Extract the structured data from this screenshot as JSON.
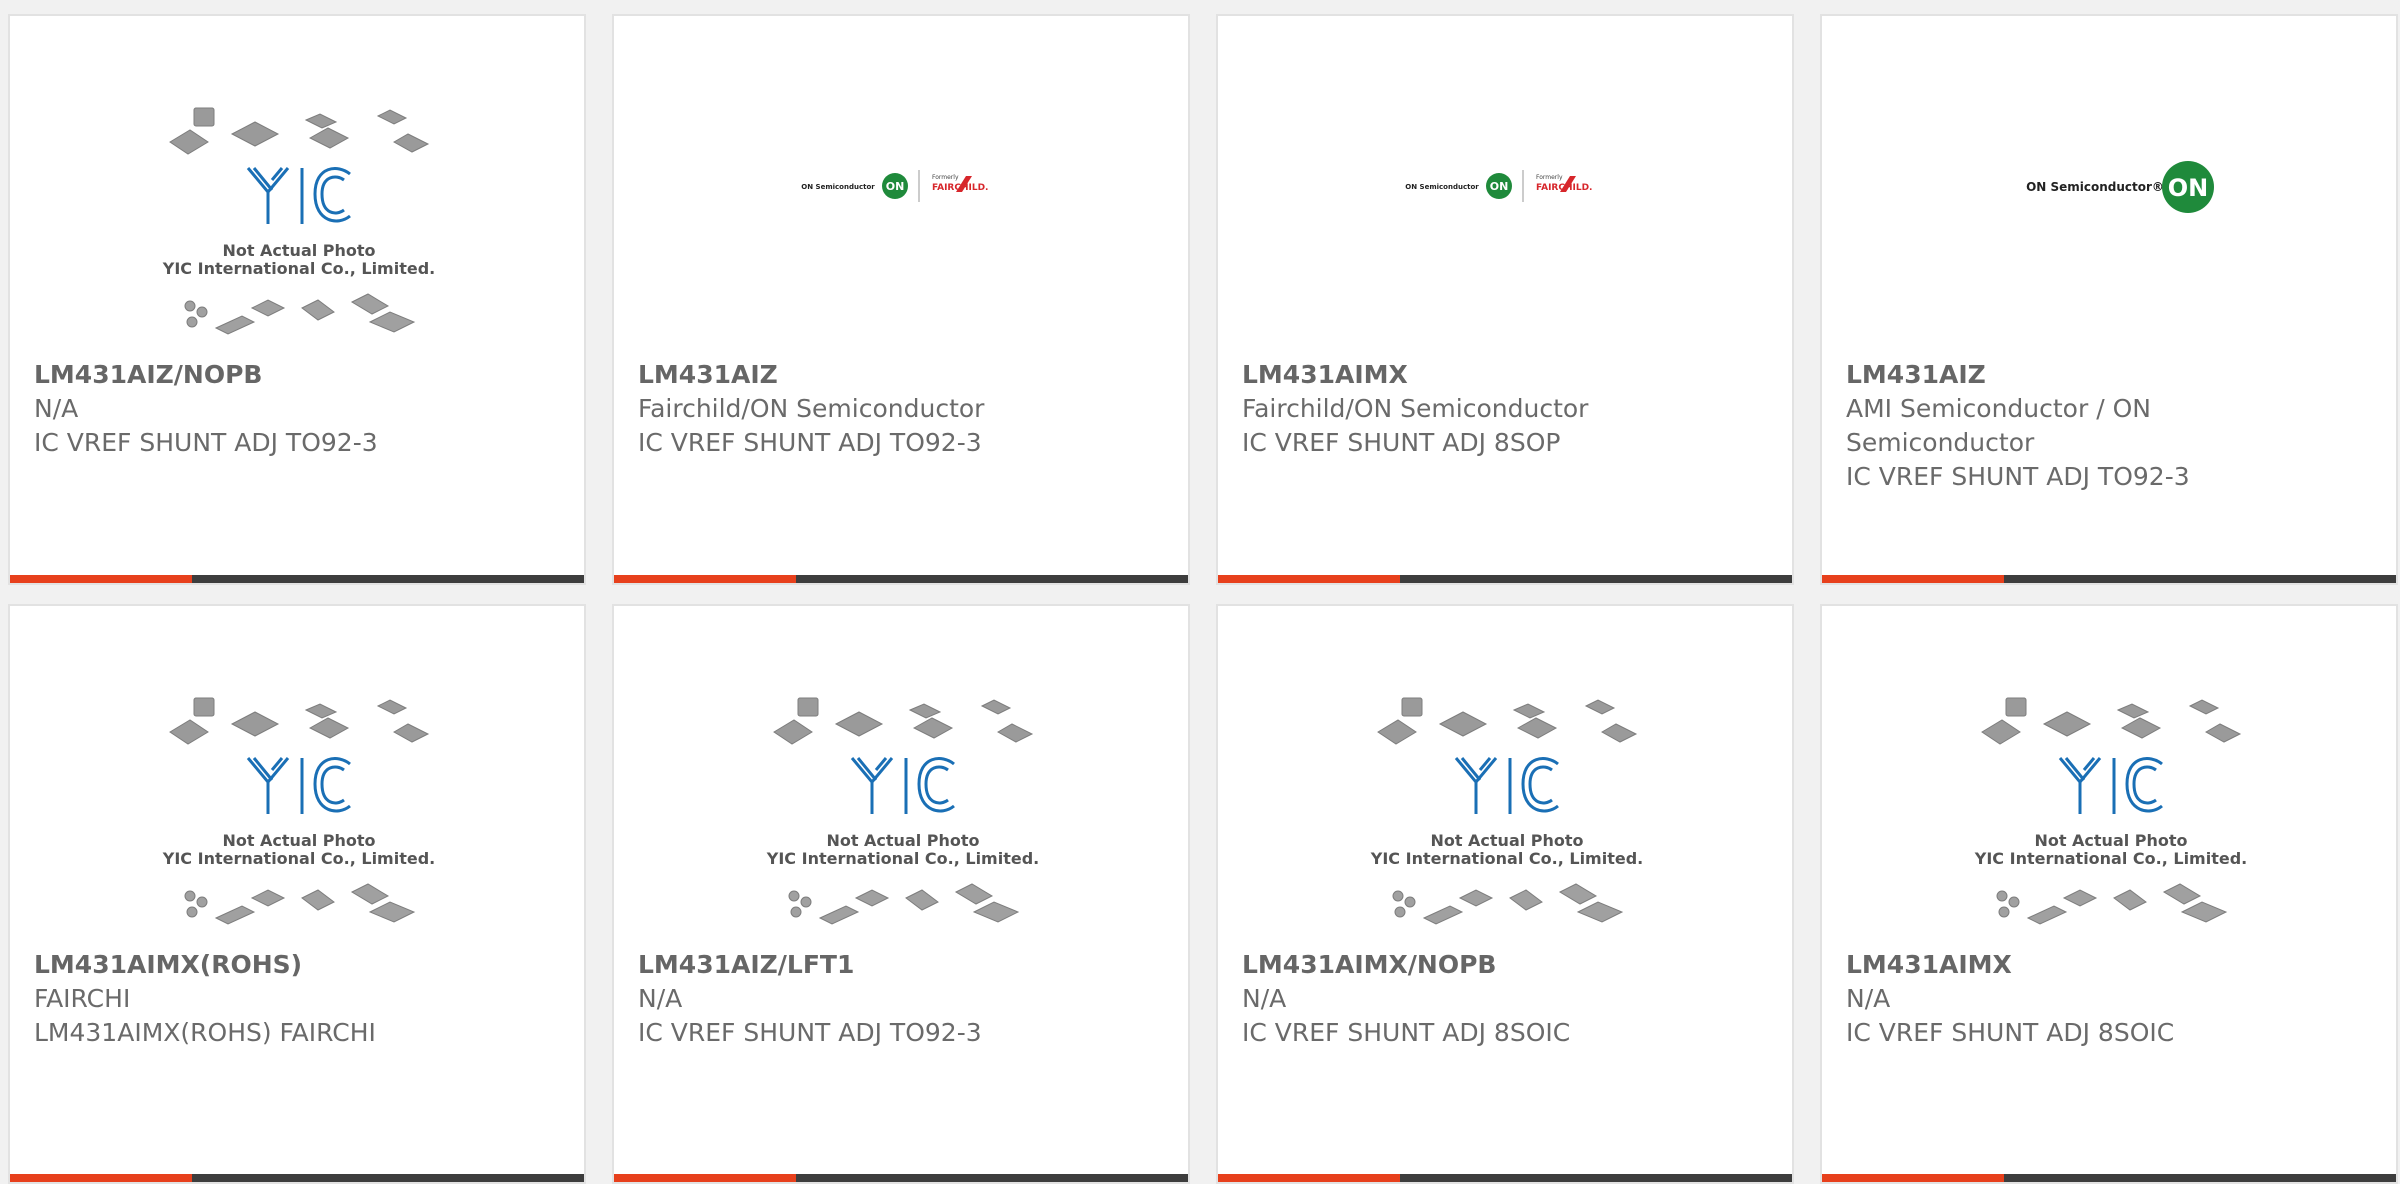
{
  "products": [
    {
      "part_number": "LM431AIZ/NOPB",
      "manufacturer": "N/A",
      "description": "IC VREF SHUNT ADJ TO92-3",
      "image": "yic-placeholder",
      "placeholder_line1": "Not Actual Photo",
      "placeholder_line2": "YIC International Co., Limited."
    },
    {
      "part_number": "LM431AIZ",
      "manufacturer": "Fairchild/ON Semiconductor",
      "description": "IC VREF SHUNT ADJ TO92-3",
      "image": "fairchild-on-logo",
      "logo_text_left": "ON Semiconductor",
      "logo_text_right_small": "Formerly",
      "logo_text_right": "FAIRCHILD."
    },
    {
      "part_number": "LM431AIMX",
      "manufacturer": "Fairchild/ON Semiconductor",
      "description": "IC VREF SHUNT ADJ 8SOP",
      "image": "fairchild-on-logo",
      "logo_text_left": "ON Semiconductor",
      "logo_text_right_small": "Formerly",
      "logo_text_right": "FAIRCHILD."
    },
    {
      "part_number": "LM431AIZ",
      "manufacturer_line1": "AMI Semiconductor / ON",
      "manufacturer_line2": "Semiconductor",
      "description": "IC VREF SHUNT ADJ TO92-3",
      "image": "on-semiconductor-logo",
      "logo_text": "ON Semiconductor®",
      "logo_mark": "ON"
    },
    {
      "part_number": "LM431AIMX(ROHS)",
      "manufacturer": "FAIRCHI",
      "description": "LM431AIMX(ROHS) FAIRCHI",
      "image": "yic-placeholder",
      "placeholder_line1": "Not Actual Photo",
      "placeholder_line2": "YIC International Co., Limited."
    },
    {
      "part_number": "LM431AIZ/LFT1",
      "manufacturer": "N/A",
      "description": "IC VREF SHUNT ADJ TO92-3",
      "image": "yic-placeholder",
      "placeholder_line1": "Not Actual Photo",
      "placeholder_line2": "YIC International Co., Limited."
    },
    {
      "part_number": "LM431AIMX/NOPB",
      "manufacturer": "N/A",
      "description": "IC VREF SHUNT ADJ 8SOIC",
      "image": "yic-placeholder",
      "placeholder_line1": "Not Actual Photo",
      "placeholder_line2": "YIC International Co., Limited."
    },
    {
      "part_number": "LM431AIMX",
      "manufacturer": "N/A",
      "description": "IC VREF SHUNT ADJ 8SOIC",
      "image": "yic-placeholder",
      "placeholder_line1": "Not Actual Photo",
      "placeholder_line2": "YIC International Co., Limited."
    }
  ],
  "colors": {
    "accent": "#e7401c",
    "bar": "#3d3d3d",
    "yic_blue": "#1a6fb5",
    "on_green": "#1f8a3b",
    "fairchild_red": "#d7262b"
  }
}
